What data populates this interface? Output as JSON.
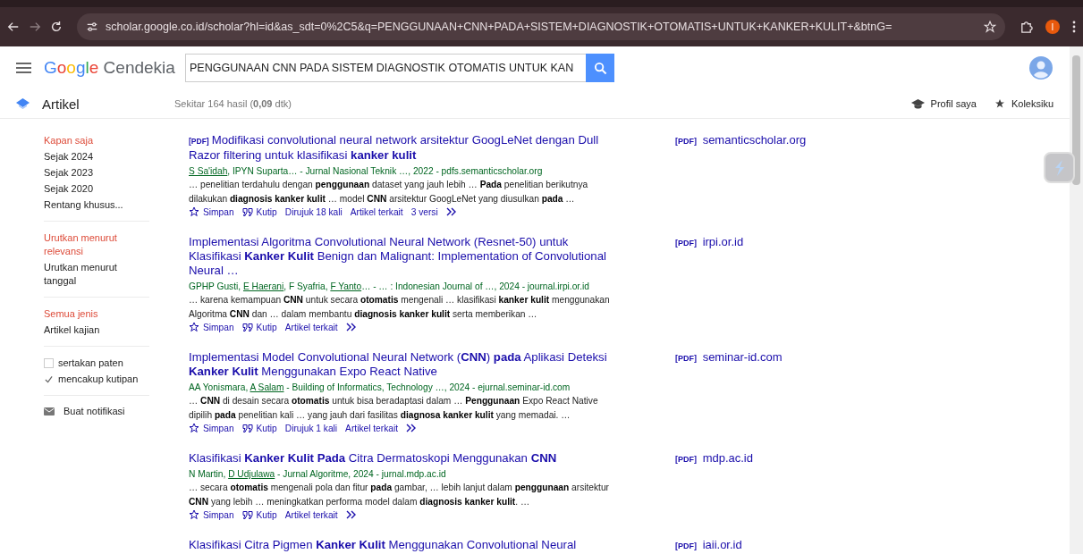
{
  "browser": {
    "url": "scholar.google.co.id/scholar?hl=id&as_sdt=0%2C5&q=PENGGUNAAN+CNN+PADA+SISTEM+DIAGNOSTIK+OTOMATIS+UNTUK+KANKER+KULIT+&btnG=",
    "profile_letter": "I"
  },
  "header": {
    "logo_brand": "Google",
    "logo_product": "Cendekia",
    "search": {
      "value": "PENGGUNAAN CNN PADA SISTEM DIAGNOSTIK OTOMATIS UNTUK KAN"
    }
  },
  "subheader": {
    "section": "Artikel",
    "result_count": "Sekitar 164 hasil (**0,09** dtk)",
    "links": [
      {
        "kind": "profile",
        "label": "Profil saya"
      },
      {
        "kind": "collection",
        "label": "Koleksiku"
      }
    ]
  },
  "sidebar": {
    "groups": [
      {
        "kind": "links",
        "items": [
          {
            "label": "Kapan saja",
            "selected": true
          },
          {
            "label": "Sejak 2024",
            "selected": false
          },
          {
            "label": "Sejak 2023",
            "selected": false
          },
          {
            "label": "Sejak 2020",
            "selected": false
          },
          {
            "label": "Rentang khusus...",
            "selected": false
          }
        ]
      },
      {
        "kind": "links",
        "items": [
          {
            "label": "Urutkan menurut relevansi",
            "selected": true
          },
          {
            "label": "Urutkan menurut tanggal",
            "selected": false
          }
        ]
      },
      {
        "kind": "links",
        "items": [
          {
            "label": "Semua jenis",
            "selected": true
          },
          {
            "label": "Artikel kajian",
            "selected": false
          }
        ]
      },
      {
        "kind": "checkboxes",
        "items": [
          {
            "label": "sertakan paten",
            "checked": false
          },
          {
            "label": "mencakup kutipan",
            "checked": true
          }
        ]
      },
      {
        "kind": "alert",
        "items": [
          {
            "label": "Buat notifikasi"
          }
        ]
      }
    ]
  },
  "results": [
    {
      "pdf_tag": "[PDF]",
      "title": "Modifikasi convolutional neural network arsitektur GoogLeNet dengan Dull Razor filtering untuk klasifikasi **kanker kulit**",
      "authors": [
        {
          "text": "S Sa'idah",
          "linked": true
        },
        {
          "text": ", IPYN Suparta… - Jurnal Nasional Teknik …, 2022 - pdfs.semanticscholar.org",
          "linked": false
        }
      ],
      "snippet": "… penelitian terdahulu dengan **penggunaan** dataset yang jauh lebih … **Pada** penelitian berikutnya dilakukan **diagnosis kanker kulit** … model **CNN** arsitektur GoogLeNet yang diusulkan **pada** …",
      "actions": [
        {
          "kind": "save",
          "label": "Simpan"
        },
        {
          "kind": "cite",
          "label": "Kutip"
        },
        {
          "kind": "link",
          "label": "Dirujuk 18 kali"
        },
        {
          "kind": "link",
          "label": "Artikel terkait"
        },
        {
          "kind": "link",
          "label": "3 versi"
        },
        {
          "kind": "more"
        }
      ],
      "side_tag": "[PDF]",
      "side_domain": "semanticscholar.org"
    },
    {
      "title": "Implementasi Algoritma Convolutional Neural Network (Resnet-50) untuk Klasifikasi **Kanker Kulit** Benign dan Malignant: Implementation of Convolutional Neural …",
      "authors": [
        {
          "text": "GPHP Gusti, ",
          "linked": false
        },
        {
          "text": "E Haerani",
          "linked": true
        },
        {
          "text": ", F Syafria, ",
          "linked": false
        },
        {
          "text": "F Yanto",
          "linked": true
        },
        {
          "text": "… - … : Indonesian Journal of …, 2024 - journal.irpi.or.id",
          "linked": false
        }
      ],
      "snippet": "… karena kemampuan **CNN** untuk secara **otomatis** mengenali … klasifikasi **kanker kulit** menggunakan Algoritma **CNN** dan … dalam membantu **diagnosis kanker kulit** serta memberikan …",
      "actions": [
        {
          "kind": "save",
          "label": "Simpan"
        },
        {
          "kind": "cite",
          "label": "Kutip"
        },
        {
          "kind": "link",
          "label": "Artikel terkait"
        },
        {
          "kind": "more"
        }
      ],
      "side_tag": "[PDF]",
      "side_domain": "irpi.or.id"
    },
    {
      "title": "Implementasi Model Convolutional Neural Network (**CNN**) **pada** Aplikasi Deteksi **Kanker Kulit** Menggunakan Expo React Native",
      "authors": [
        {
          "text": "AA Yonismara, ",
          "linked": false
        },
        {
          "text": "A Salam",
          "linked": true
        },
        {
          "text": " - Building of Informatics, Technology …, 2024 - ejurnal.seminar-id.com",
          "linked": false
        }
      ],
      "snippet": "… **CNN** di desain secara **otomatis** untuk bisa beradaptasi dalam … **Penggunaan** Expo React Native dipilih **pada** penelitian kali … yang jauh dari fasilitas **diagnosa kanker kulit** yang memadai. …",
      "actions": [
        {
          "kind": "save",
          "label": "Simpan"
        },
        {
          "kind": "cite",
          "label": "Kutip"
        },
        {
          "kind": "link",
          "label": "Dirujuk 1 kali"
        },
        {
          "kind": "link",
          "label": "Artikel terkait"
        },
        {
          "kind": "more"
        }
      ],
      "side_tag": "[PDF]",
      "side_domain": "seminar-id.com"
    },
    {
      "title": "Klasifikasi **Kanker Kulit Pada** Citra Dermatoskopi Menggunakan **CNN**",
      "authors": [
        {
          "text": "N Martin, ",
          "linked": false
        },
        {
          "text": "D Udjulawa",
          "linked": true
        },
        {
          "text": " - Jurnal Algoritme, 2024 - jurnal.mdp.ac.id",
          "linked": false
        }
      ],
      "snippet": "… secara **otomatis** mengenali pola dan fitur **pada** gambar, … lebih lanjut dalam **penggunaan** arsitektur **CNN** yang lebih … meningkatkan performa model dalam **diagnosis kanker kulit**. …",
      "actions": [
        {
          "kind": "save",
          "label": "Simpan"
        },
        {
          "kind": "cite",
          "label": "Kutip"
        },
        {
          "kind": "link",
          "label": "Artikel terkait"
        },
        {
          "kind": "more"
        }
      ],
      "side_tag": "[PDF]",
      "side_domain": "mdp.ac.id"
    },
    {
      "title": "Klasifikasi Citra Pigmen **Kanker Kulit** Menggunakan Convolutional Neural",
      "side_tag": "[PDF]",
      "side_domain": "iaii.or.id"
    }
  ]
}
